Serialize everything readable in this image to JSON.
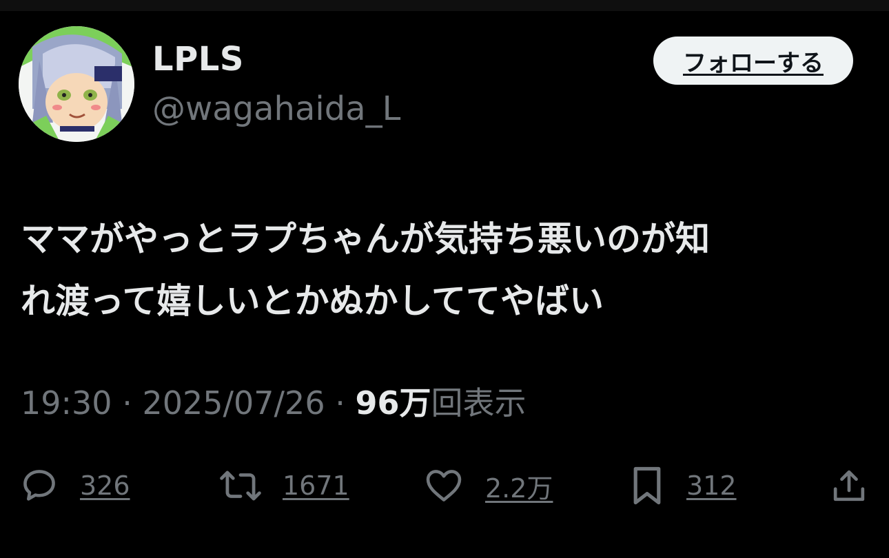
{
  "user": {
    "display_name": "LPLS",
    "handle": "@wagahaida_L",
    "follow_label": "フォローする"
  },
  "tweet": {
    "text_line1": "ママがやっとラプちゃんが気持ち悪いのが知",
    "text_line2": "れ渡って嬉しいとかぬかしててやばい"
  },
  "meta": {
    "time": "19:30",
    "separator": "·",
    "date": "2025/07/26",
    "views_count": "96万",
    "views_label": "回表示"
  },
  "actions": {
    "reply_icon": "reply-bubble-icon",
    "reply_count": "326",
    "retweet_icon": "retweet-icon",
    "retweet_count": "1671",
    "like_icon": "heart-icon",
    "like_count": "2.2万",
    "bookmark_icon": "bookmark-icon",
    "bookmark_count": "312",
    "share_icon": "share-icon"
  },
  "colors": {
    "background": "#000000",
    "primary_text": "#e7e9ea",
    "secondary_text": "#71767b",
    "button_bg": "#eff3f4"
  }
}
